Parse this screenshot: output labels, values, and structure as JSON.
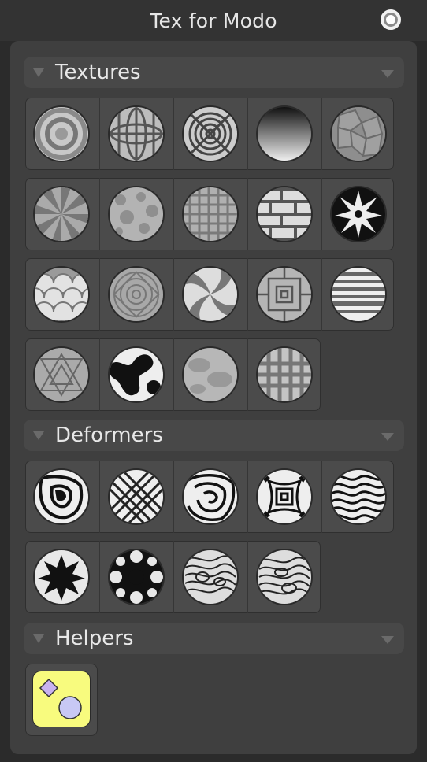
{
  "window": {
    "title": "Tex for Modo"
  },
  "sections": [
    {
      "label": "Textures",
      "items": [
        "rings",
        "grid-lattice",
        "concentric-squares",
        "gradient",
        "voronoi",
        "radial-sunburst",
        "noise",
        "plaid",
        "brick",
        "star",
        "scales",
        "radial-pattern",
        "swirl",
        "square-tiles",
        "stripes",
        "triangle-pattern",
        "blob-noise",
        "cloud-noise",
        "weave"
      ]
    },
    {
      "label": "Deformers",
      "items": [
        "warp",
        "x-cross",
        "square-swirl",
        "square-pattern",
        "wave",
        "flower-black",
        "flower-dots",
        "ripple-a",
        "ripple-b"
      ]
    },
    {
      "label": "Helpers",
      "items": [
        "shape-helper"
      ]
    }
  ],
  "colors": {
    "background": "#2b2b2b",
    "panel": "#3f3f3f",
    "header": "#484848",
    "helper_tile": "#f8fb7e",
    "helper_shapes": "#c8b2f0"
  }
}
